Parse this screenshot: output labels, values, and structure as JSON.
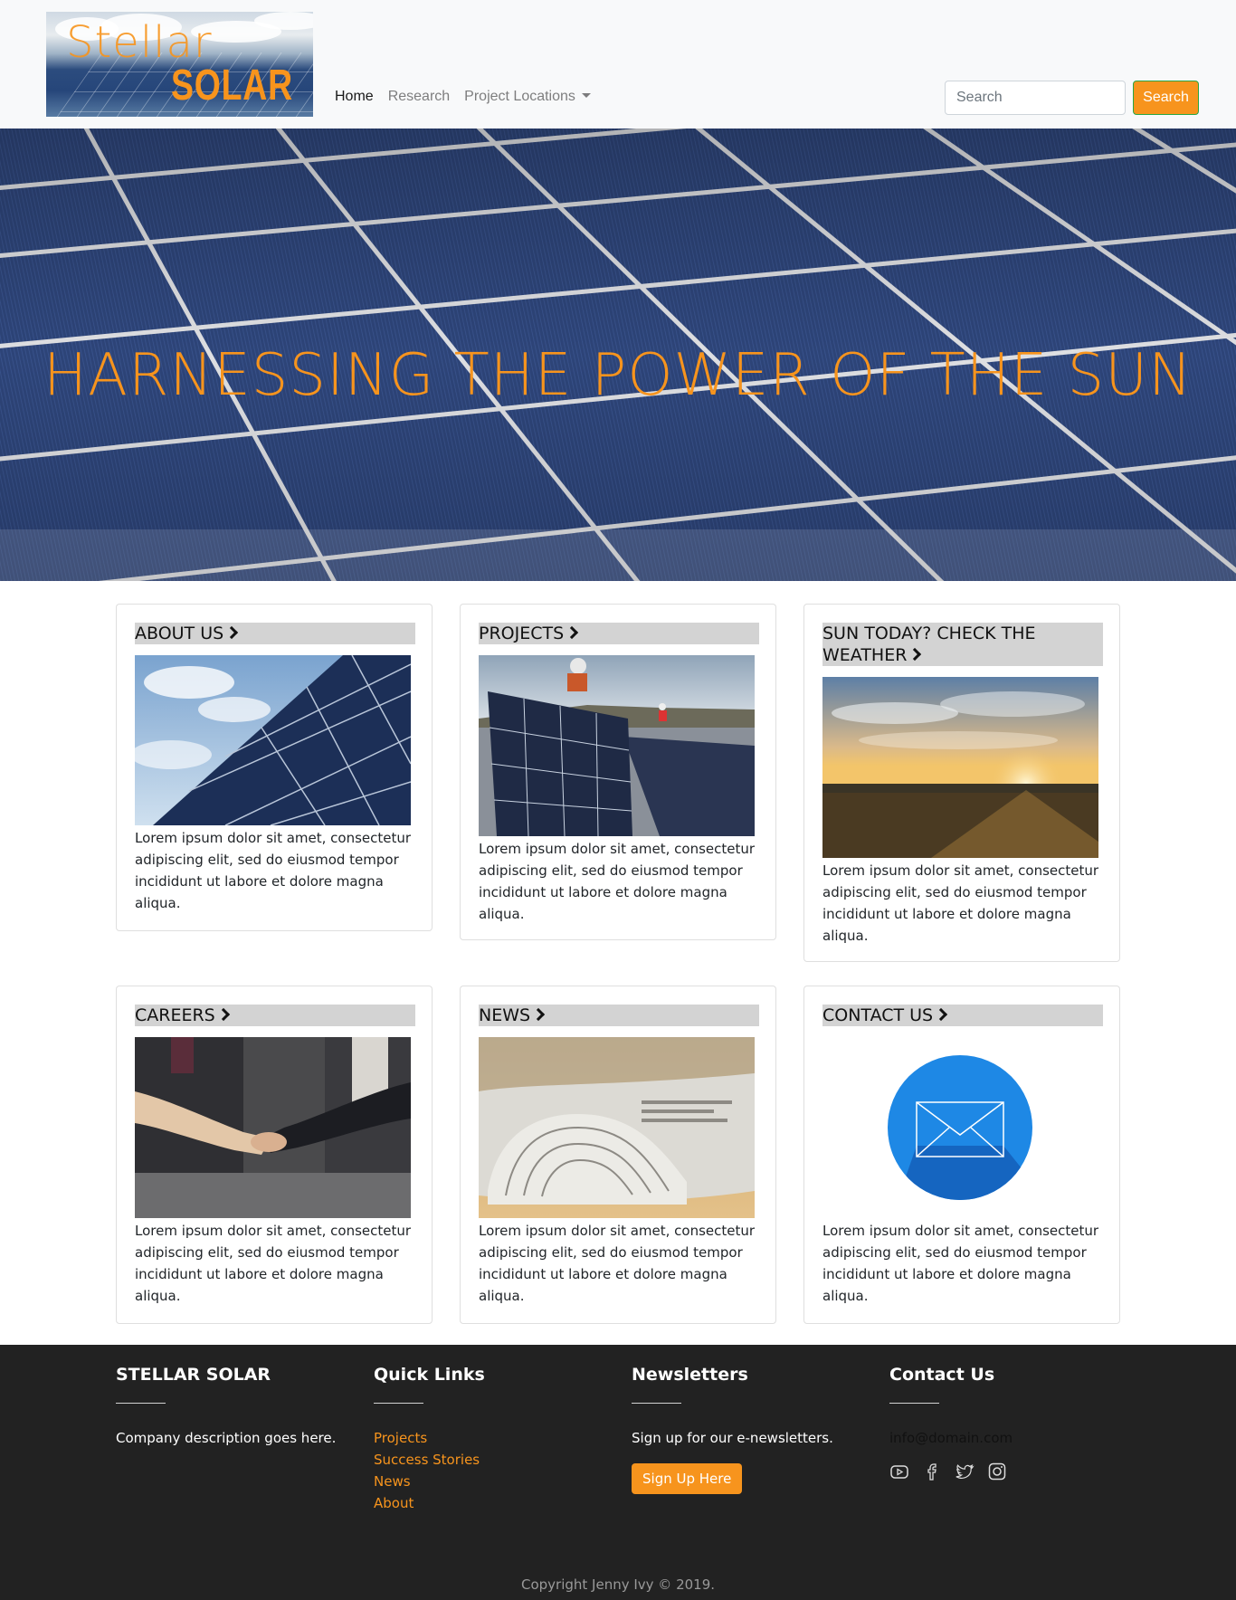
{
  "nav": {
    "logo": {
      "top": "Stellar",
      "bottom": "SOLAR"
    },
    "links": [
      {
        "label": "Home",
        "active": true
      },
      {
        "label": "Research",
        "active": false
      },
      {
        "label": "Project Locations",
        "active": false,
        "dropdown": true
      }
    ],
    "search_placeholder": "Search",
    "search_button": "Search"
  },
  "hero": {
    "title": "HARNESSING THE POWER OF THE SUN"
  },
  "cards": [
    {
      "title": "ABOUT US",
      "text": "Lorem ipsum dolor sit amet, consectetur adipiscing elit, sed do eiusmod tempor incididunt ut labore et dolore magna aliqua.",
      "image": "solar-panels-sky"
    },
    {
      "title": "PROJECTS",
      "text": "Lorem ipsum dolor sit amet, consectetur adipiscing elit, sed do eiusmod tempor incididunt ut labore et dolore magna aliqua.",
      "image": "workers-installing-panels"
    },
    {
      "title": "SUN TODAY? CHECK THE WEATHER",
      "text": "Lorem ipsum dolor sit amet, consectetur adipiscing elit, sed do eiusmod tempor incididunt ut labore et dolore magna aliqua.",
      "image": "sunrise-field"
    },
    {
      "title": "CAREERS",
      "text": "Lorem ipsum dolor sit amet, consectetur adipiscing elit, sed do eiusmod tempor incididunt ut labore et dolore magna aliqua.",
      "image": "handshake"
    },
    {
      "title": "NEWS",
      "text": "Lorem ipsum dolor sit amet, consectetur adipiscing elit, sed do eiusmod tempor incididunt ut labore et dolore magna aliqua.",
      "image": "newspaper"
    },
    {
      "title": "CONTACT US",
      "text": "Lorem ipsum dolor sit amet, consectetur adipiscing elit, sed do eiusmod tempor incididunt ut labore et dolore magna aliqua.",
      "image": "envelope-icon"
    }
  ],
  "footer": {
    "company": {
      "heading": "STELLAR SOLAR",
      "text": "Company description goes here."
    },
    "quick_links": {
      "heading": "Quick Links",
      "links": [
        "Projects",
        "Success Stories",
        "News",
        "About"
      ]
    },
    "newsletters": {
      "heading": "Newsletters",
      "text": "Sign up for our e-newsletters.",
      "button": "Sign Up Here"
    },
    "contact": {
      "heading": "Contact Us",
      "email": "info@domain.com",
      "socials": [
        "youtube-icon",
        "facebook-icon",
        "twitter-icon",
        "instagram-icon"
      ]
    },
    "copyright": "Copyright Jenny Ivy © 2019."
  },
  "colors": {
    "accent": "#f7941d",
    "footer_bg": "#222222",
    "title_bg": "#d3d3d3",
    "mail_blue": "#1e88e5"
  }
}
